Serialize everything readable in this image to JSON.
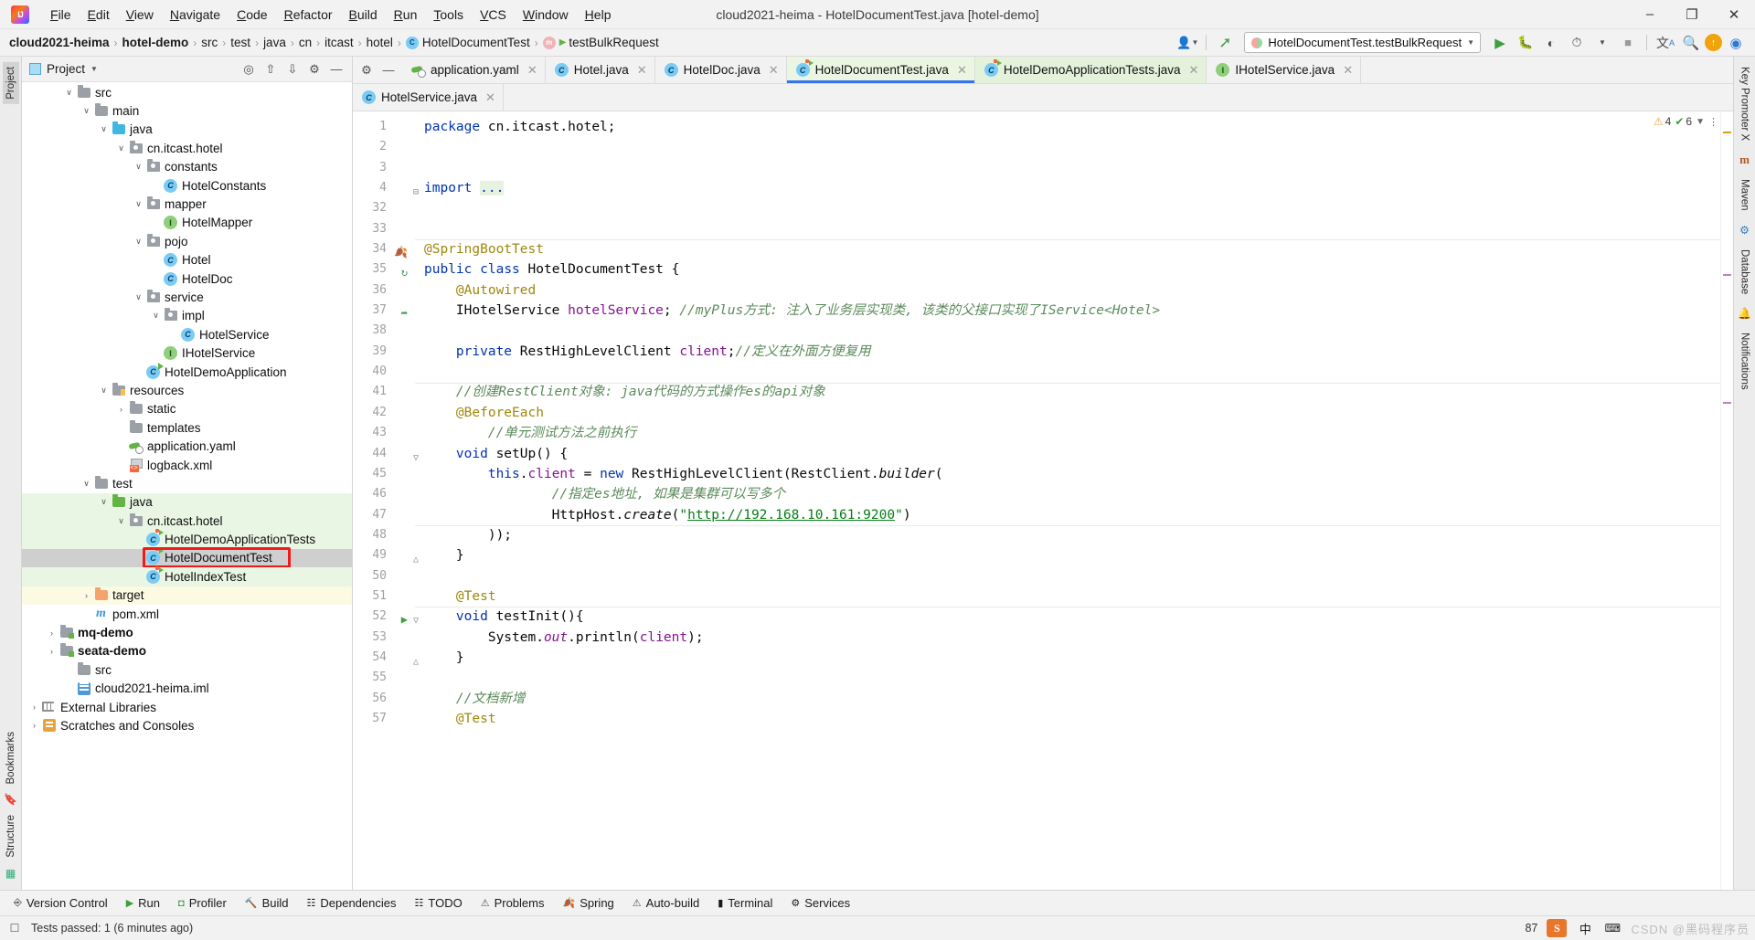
{
  "window": {
    "title": "cloud2021-heima - HotelDocumentTest.java [hotel-demo]",
    "minimize": "–",
    "maximize": "❐",
    "close": "✕"
  },
  "menubar": {
    "logo": "IJ",
    "items": [
      "File",
      "Edit",
      "View",
      "Navigate",
      "Code",
      "Refactor",
      "Build",
      "Run",
      "Tools",
      "VCS",
      "Window",
      "Help"
    ]
  },
  "breadcrumb": {
    "items": [
      {
        "label": "cloud2021-heima",
        "bold": true,
        "icon": ""
      },
      {
        "label": "hotel-demo",
        "bold": true,
        "icon": ""
      },
      {
        "label": "src",
        "bold": false,
        "icon": ""
      },
      {
        "label": "test",
        "bold": false,
        "icon": ""
      },
      {
        "label": "java",
        "bold": false,
        "icon": ""
      },
      {
        "label": "cn",
        "bold": false,
        "icon": ""
      },
      {
        "label": "itcast",
        "bold": false,
        "icon": ""
      },
      {
        "label": "hotel",
        "bold": false,
        "icon": ""
      },
      {
        "label": "HotelDocumentTest",
        "bold": false,
        "icon": "class-icon"
      },
      {
        "label": "testBulkRequest",
        "bold": false,
        "icon": "method-icon"
      }
    ]
  },
  "toolbar": {
    "run_config": "HotelDocumentTest.testBulkRequest",
    "avatar_icon": "user-icon",
    "updates_icon": "vcs-update-icon",
    "run_icon": "▶",
    "debug_icon": "debug-icon",
    "coverage_icon": "coverage-icon",
    "profile_icon": "profile-icon",
    "stop_icon": "■",
    "translate_icon": "translate-icon",
    "search_icon": "⌕",
    "update_badge_icon": "update-arrow-icon",
    "ide_icon": "ide-icon"
  },
  "project_panel": {
    "title": "Project",
    "header_icons": [
      "locate-icon",
      "expand-all-icon",
      "collapse-all-icon",
      "settings-gear-icon",
      "hide-icon"
    ],
    "tree": [
      {
        "indent": 2,
        "arrow": "∨",
        "icon": "folder-gray",
        "label": "src",
        "state": "",
        "partial": true
      },
      {
        "indent": 3,
        "arrow": "∨",
        "icon": "folder-gray",
        "label": "main",
        "state": ""
      },
      {
        "indent": 4,
        "arrow": "∨",
        "icon": "folder-blue",
        "label": "java",
        "state": ""
      },
      {
        "indent": 5,
        "arrow": "∨",
        "icon": "package",
        "label": "cn.itcast.hotel",
        "state": ""
      },
      {
        "indent": 6,
        "arrow": "∨",
        "icon": "package",
        "label": "constants",
        "state": ""
      },
      {
        "indent": 7,
        "arrow": "",
        "icon": "class",
        "label": "HotelConstants",
        "state": ""
      },
      {
        "indent": 6,
        "arrow": "∨",
        "icon": "package",
        "label": "mapper",
        "state": ""
      },
      {
        "indent": 7,
        "arrow": "",
        "icon": "interface",
        "label": "HotelMapper",
        "state": ""
      },
      {
        "indent": 6,
        "arrow": "∨",
        "icon": "package",
        "label": "pojo",
        "state": ""
      },
      {
        "indent": 7,
        "arrow": "",
        "icon": "class",
        "label": "Hotel",
        "state": ""
      },
      {
        "indent": 7,
        "arrow": "",
        "icon": "class",
        "label": "HotelDoc",
        "state": ""
      },
      {
        "indent": 6,
        "arrow": "∨",
        "icon": "package",
        "label": "service",
        "state": ""
      },
      {
        "indent": 7,
        "arrow": "∨",
        "icon": "package",
        "label": "impl",
        "state": ""
      },
      {
        "indent": 8,
        "arrow": "",
        "icon": "class",
        "label": "HotelService",
        "state": ""
      },
      {
        "indent": 7,
        "arrow": "",
        "icon": "interface",
        "label": "IHotelService",
        "state": ""
      },
      {
        "indent": 6,
        "arrow": "",
        "icon": "class-run",
        "label": "HotelDemoApplication",
        "state": ""
      },
      {
        "indent": 4,
        "arrow": "∨",
        "icon": "folder-res",
        "label": "resources",
        "state": ""
      },
      {
        "indent": 5,
        "arrow": "›",
        "icon": "folder-gray",
        "label": "static",
        "state": ""
      },
      {
        "indent": 5,
        "arrow": "",
        "icon": "folder-gray",
        "label": "templates",
        "state": ""
      },
      {
        "indent": 5,
        "arrow": "",
        "icon": "yaml-file",
        "label": "application.yaml",
        "state": ""
      },
      {
        "indent": 5,
        "arrow": "",
        "icon": "xml-file",
        "label": "logback.xml",
        "state": ""
      },
      {
        "indent": 3,
        "arrow": "∨",
        "icon": "folder-gray",
        "label": "test",
        "state": ""
      },
      {
        "indent": 4,
        "arrow": "∨",
        "icon": "folder-green",
        "label": "java",
        "state": "green"
      },
      {
        "indent": 5,
        "arrow": "∨",
        "icon": "package",
        "label": "cn.itcast.hotel",
        "state": "green"
      },
      {
        "indent": 6,
        "arrow": "",
        "icon": "class-test",
        "label": "HotelDemoApplicationTests",
        "state": "green"
      },
      {
        "indent": 6,
        "arrow": "",
        "icon": "class-test",
        "label": "HotelDocumentTest",
        "state": "selected"
      },
      {
        "indent": 6,
        "arrow": "",
        "icon": "class-test",
        "label": "HotelIndexTest",
        "state": "green"
      },
      {
        "indent": 3,
        "arrow": "›",
        "icon": "folder-orange",
        "label": "target",
        "state": "yellow"
      },
      {
        "indent": 3,
        "arrow": "",
        "icon": "maven",
        "label": "pom.xml",
        "state": ""
      },
      {
        "indent": 1,
        "arrow": "›",
        "icon": "folder-mod",
        "label": "mq-demo",
        "state": "",
        "bold": true
      },
      {
        "indent": 1,
        "arrow": "›",
        "icon": "folder-mod",
        "label": "seata-demo",
        "state": "",
        "bold": true
      },
      {
        "indent": 2,
        "arrow": "",
        "icon": "folder-gray",
        "label": "src",
        "state": ""
      },
      {
        "indent": 2,
        "arrow": "",
        "icon": "iml-file",
        "label": "cloud2021-heima.iml",
        "state": ""
      },
      {
        "indent": 0,
        "arrow": "›",
        "icon": "library",
        "label": "External Libraries",
        "state": ""
      },
      {
        "indent": 0,
        "arrow": "›",
        "icon": "scratch",
        "label": "Scratches and Consoles",
        "state": ""
      }
    ]
  },
  "editor": {
    "tabs_row1": [
      {
        "label": "application.yaml",
        "icon": "yaml-file",
        "state": "plain"
      },
      {
        "label": "Hotel.java",
        "icon": "class",
        "state": "plain"
      },
      {
        "label": "HotelDoc.java",
        "icon": "class",
        "state": "plain"
      },
      {
        "label": "HotelDocumentTest.java",
        "icon": "class-test",
        "state": "active"
      },
      {
        "label": "HotelDemoApplicationTests.java",
        "icon": "class-test",
        "state": "green"
      },
      {
        "label": "IHotelService.java",
        "icon": "interface",
        "state": "plain"
      }
    ],
    "tabs_row2": [
      {
        "label": "HotelService.java",
        "icon": "class",
        "state": "plain"
      }
    ],
    "inspection": {
      "warnings": "4",
      "weak": "6",
      "warn_icon": "⚠",
      "weak_icon": "✔"
    },
    "lines": [
      {
        "num": "1",
        "mark": "",
        "fold": "",
        "html": "<span class=\"kw\">package</span> cn.itcast.hotel;"
      },
      {
        "num": "2",
        "mark": "",
        "fold": "",
        "html": ""
      },
      {
        "num": "3",
        "mark": "",
        "fold": "",
        "html": ""
      },
      {
        "num": "4",
        "mark": "",
        "fold": "⊟",
        "html": "<span class=\"kw\">import</span> <span style=\"background:#e8f2e0;color:#0033b3\">...</span>"
      },
      {
        "num": "32",
        "mark": "",
        "fold": "",
        "html": ""
      },
      {
        "num": "33",
        "mark": "",
        "fold": "",
        "html": ""
      },
      {
        "num": "34",
        "mark": "spring",
        "fold": "",
        "html": "<span class=\"ann\">@SpringBootTest</span>"
      },
      {
        "num": "35",
        "mark": "impl",
        "fold": "",
        "html": "<span class=\"kw\">public</span> <span class=\"kw\">class</span> HotelDocumentTest {"
      },
      {
        "num": "36",
        "mark": "",
        "fold": "",
        "html": "    <span class=\"ann\">@Autowired</span>"
      },
      {
        "num": "37",
        "mark": "bean",
        "fold": "",
        "html": "    IHotelService <span class=\"fld2\">hotelService</span>; <span class=\"cmtg\">//myPlus方式: 注入了业务层实现类, 该类的父接口实现了IService&lt;Hotel&gt;</span>"
      },
      {
        "num": "38",
        "mark": "",
        "fold": "",
        "html": ""
      },
      {
        "num": "39",
        "mark": "",
        "fold": "",
        "html": "    <span class=\"kw\">private</span> RestHighLevelClient <span class=\"fld2\">client</span>;<span class=\"cmtg\">//定义在外面方便复用</span>"
      },
      {
        "num": "40",
        "mark": "",
        "fold": "",
        "html": ""
      },
      {
        "num": "41",
        "mark": "",
        "fold": "",
        "html": "    <span class=\"cmtg\">//创建RestClient对象: java代码的方式操作es的api对象</span>"
      },
      {
        "num": "42",
        "mark": "",
        "fold": "",
        "html": "    <span class=\"ann\">@BeforeEach</span>"
      },
      {
        "num": "43",
        "mark": "",
        "fold": "",
        "html": "        <span class=\"cmtg\">//单元测试方法之前执行</span>"
      },
      {
        "num": "44",
        "mark": "",
        "fold": "▽",
        "html": "    <span class=\"kw\">void</span> setUp() {"
      },
      {
        "num": "45",
        "mark": "",
        "fold": "",
        "html": "        <span class=\"kw\">this</span>.<span class=\"fld2\">client</span> = <span class=\"kw\">new</span> RestHighLevelClient(RestClient.<span class=\"ital\">builder</span>("
      },
      {
        "num": "46",
        "mark": "",
        "fold": "",
        "html": "                <span class=\"cmtg\">//指定es地址, 如果是集群可以写多个</span>"
      },
      {
        "num": "47",
        "mark": "",
        "fold": "",
        "html": "                HttpHost.<span class=\"ital\">create</span>(<span class=\"str\">\"</span><span class=\"lnk\">http://192.168.10.161:9200</span><span class=\"str\">\"</span>)"
      },
      {
        "num": "48",
        "mark": "",
        "fold": "",
        "html": "        ));"
      },
      {
        "num": "49",
        "mark": "",
        "fold": "△",
        "html": "    }"
      },
      {
        "num": "50",
        "mark": "",
        "fold": "",
        "html": ""
      },
      {
        "num": "51",
        "mark": "",
        "fold": "",
        "html": "    <span class=\"ann\">@Test</span>"
      },
      {
        "num": "52",
        "mark": "run",
        "fold": "▽",
        "html": "    <span class=\"kw\">void</span> testInit(){"
      },
      {
        "num": "53",
        "mark": "",
        "fold": "",
        "html": "        System.<span class=\"fld2 ital\">out</span>.println(<span class=\"fld2\">client</span>);"
      },
      {
        "num": "54",
        "mark": "",
        "fold": "△",
        "html": "    }"
      },
      {
        "num": "55",
        "mark": "",
        "fold": "",
        "html": ""
      },
      {
        "num": "56",
        "mark": "",
        "fold": "",
        "html": "    <span class=\"cmtg\">//文档新增</span>"
      },
      {
        "num": "57",
        "mark": "",
        "fold": "",
        "html": "    <span class=\"ann\">@Test</span>"
      }
    ]
  },
  "rails": {
    "left_top": [
      "Project"
    ],
    "left_bottom": [
      "Bookmarks",
      "Structure"
    ],
    "right": [
      "Key Promoter X",
      "Maven",
      "Database",
      "Notifications"
    ]
  },
  "bottom_tools": [
    {
      "label": "Version Control",
      "icon": "branch-icon"
    },
    {
      "label": "Run",
      "icon": "play-icon"
    },
    {
      "label": "Profiler",
      "icon": "profiler-icon"
    },
    {
      "label": "Build",
      "icon": "hammer-icon"
    },
    {
      "label": "Dependencies",
      "icon": "dependencies-icon"
    },
    {
      "label": "TODO",
      "icon": "todo-icon"
    },
    {
      "label": "Problems",
      "icon": "problems-icon"
    },
    {
      "label": "Spring",
      "icon": "spring-leaf-icon"
    },
    {
      "label": "Auto-build",
      "icon": "autobuild-icon"
    },
    {
      "label": "Terminal",
      "icon": "terminal-icon"
    },
    {
      "label": "Services",
      "icon": "services-icon"
    }
  ],
  "statusbar": {
    "left_icon": "event-log-icon",
    "message": "Tests passed: 1 (6 minutes ago)",
    "battery": "87",
    "ime_badge": "S",
    "lang": "中",
    "watermark": "CSDN @黑码程序员"
  }
}
